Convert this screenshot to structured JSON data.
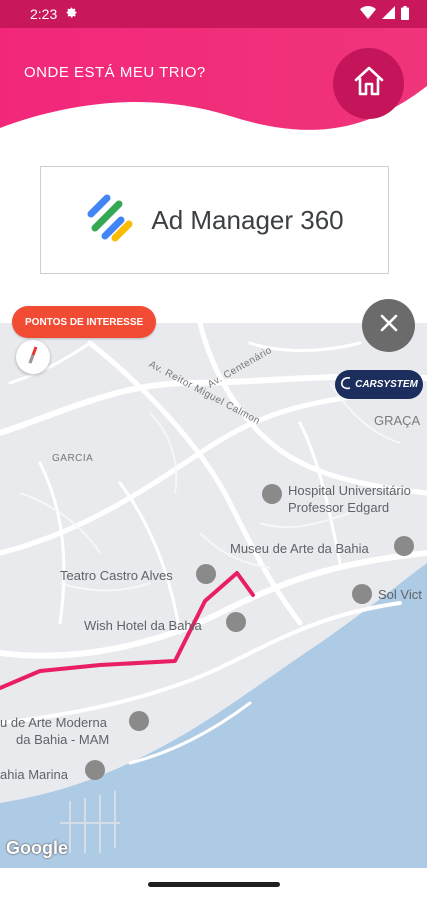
{
  "status_bar": {
    "time": "2:23"
  },
  "header": {
    "title": "ONDE ESTÁ MEU TRIO?",
    "home_icon": "home-icon"
  },
  "ad": {
    "text": "Ad Manager 360"
  },
  "map": {
    "poi_button_label": "PONTOS DE INTERESSE",
    "sponsor_label": "CARSYSTEM",
    "attribution": "Google",
    "streets": [
      "Av. Reitor Miguel Calmon",
      "Av. Centenário"
    ],
    "areas": [
      "GRAÇA",
      "GARCIA"
    ],
    "places": {
      "hospital_line1": "Hospital Universitário",
      "hospital_line2": "Professor Edgard",
      "museum": "Museu de Arte da Bahia",
      "theatre": "Teatro Castro Alves",
      "hotel": "Wish Hotel da Bahia",
      "mam_line1": "u de Arte Moderna",
      "mam_line2": "da Bahia - MAM",
      "marina": "ahia Marina",
      "sol": "Sol Vict"
    },
    "route_color": "#e91e63"
  },
  "colors": {
    "primary": "#e91e63",
    "status_bar": "#c8175a",
    "poi_button": "#f24b34",
    "sponsor": "#1b2e5e"
  }
}
